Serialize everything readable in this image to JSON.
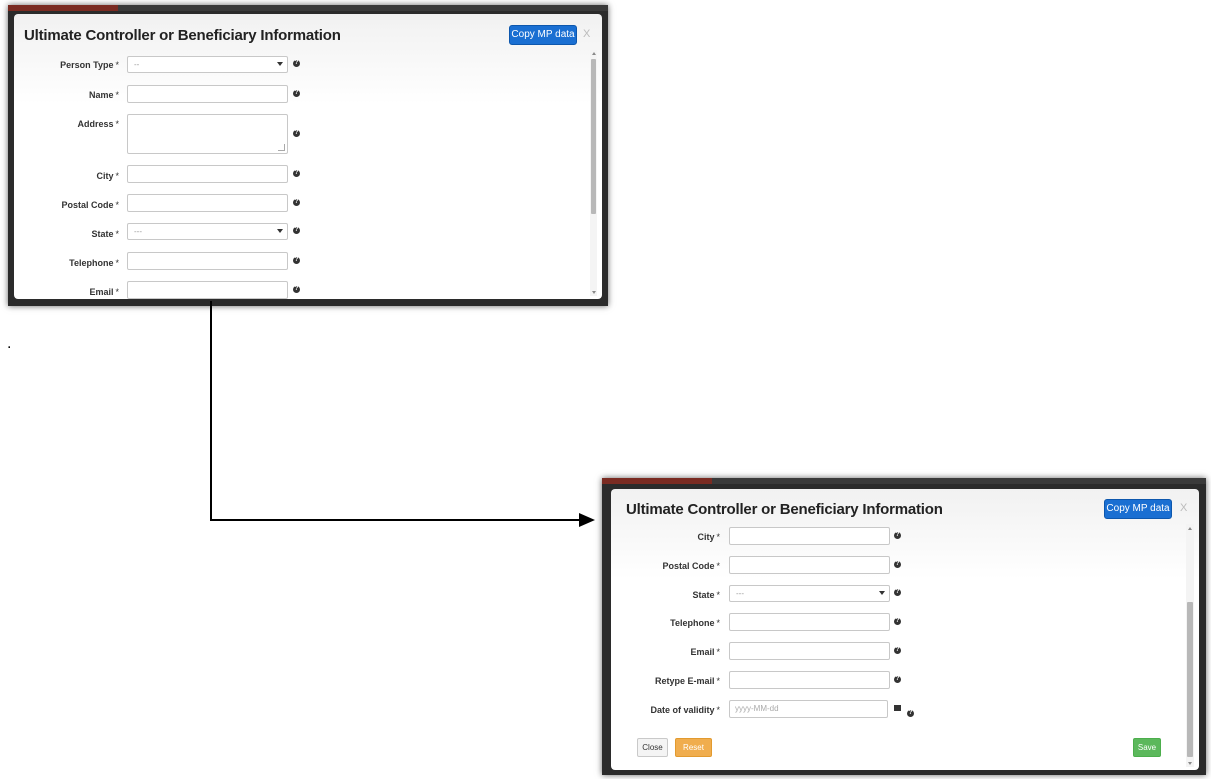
{
  "dialog": {
    "title": "Ultimate Controller or Beneficiary Information",
    "copy_button": "Copy MP data",
    "close_x": "X"
  },
  "form": {
    "person_type": {
      "label": "Person Type",
      "value": "--"
    },
    "name": {
      "label": "Name",
      "value": ""
    },
    "address": {
      "label": "Address",
      "value": ""
    },
    "city": {
      "label": "City",
      "value": ""
    },
    "postal_code": {
      "label": "Postal Code",
      "value": ""
    },
    "state": {
      "label": "State",
      "value": "---"
    },
    "telephone": {
      "label": "Telephone",
      "value": ""
    },
    "email": {
      "label": "Email",
      "value": ""
    },
    "retype_email": {
      "label": "Retype E-mail",
      "value": ""
    },
    "date_of_validity": {
      "label": "Date of validity",
      "placeholder": "yyyy-MM-dd"
    },
    "required_mark": "*"
  },
  "buttons": {
    "close": "Close",
    "reset": "Reset",
    "save": "Save"
  },
  "annotation": {
    "dot": "."
  },
  "colors": {
    "primary": "#1a6fd2",
    "warning": "#f0ad4e",
    "success": "#5cb85c"
  },
  "icons": {
    "help": "question-circle-icon",
    "calendar": "calendar-icon",
    "dropdown": "chevron-down-icon"
  }
}
